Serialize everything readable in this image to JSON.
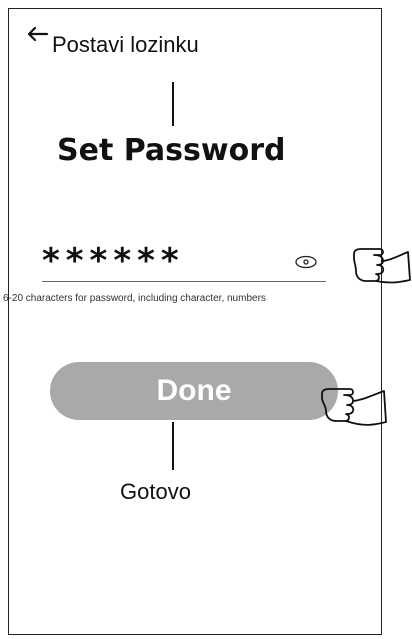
{
  "header": {
    "title": "Postavi lozinku"
  },
  "annotation": {
    "set_password": "Set Password",
    "done_caption": "Gotovo"
  },
  "password": {
    "value": "******",
    "hint": "6-20 characters for password, including character, numbers"
  },
  "actions": {
    "done_label": "Done"
  },
  "icons": {
    "back": "back-arrow-icon",
    "visibility": "eye-icon",
    "pointer": "pointing-hand-icon"
  },
  "colors": {
    "button_bg": "#a9a9a9",
    "button_text": "#ffffff"
  }
}
